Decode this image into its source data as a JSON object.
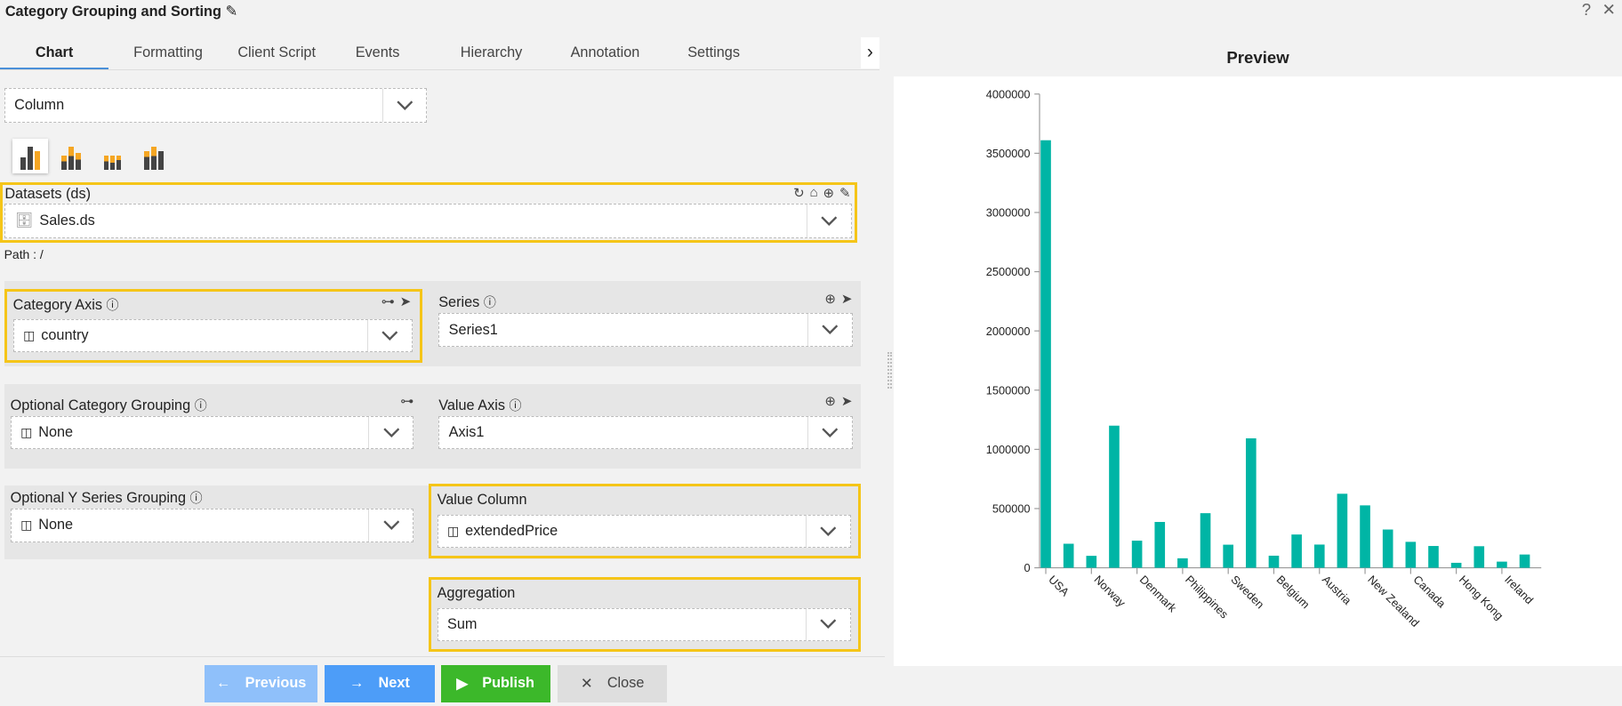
{
  "header": {
    "title": "Category Grouping and Sorting",
    "help": "?",
    "close": "✕"
  },
  "tabs": [
    "Chart",
    "Formatting",
    "Client Script",
    "Events",
    "Hierarchy",
    "Annotation",
    "Settings"
  ],
  "chart_type": {
    "value": "Column",
    "variants": [
      "clustered-column-icon",
      "stacked-column-icon",
      "100-stacked-column-icon",
      "grouped-stacked-column-icon"
    ]
  },
  "datasets": {
    "label": "Datasets (ds)",
    "value": "Sales.ds",
    "path": "Path : /"
  },
  "category_axis": {
    "label": "Category Axis",
    "value": "country"
  },
  "series": {
    "label": "Series",
    "value": "Series1"
  },
  "category_grouping": {
    "label": "Optional Category Grouping",
    "value": "None"
  },
  "value_axis": {
    "label": "Value Axis",
    "value": "Axis1"
  },
  "y_series_grouping": {
    "label": "Optional Y Series Grouping",
    "value": "None"
  },
  "value_column": {
    "label": "Value Column",
    "value": "extendedPrice"
  },
  "aggregation": {
    "label": "Aggregation",
    "value": "Sum"
  },
  "footer": {
    "previous": "Previous",
    "next": "Next",
    "publish": "Publish",
    "close": "Close"
  },
  "preview": {
    "title": "Preview"
  },
  "colors": {
    "highlight": "#f5c518",
    "bar": "#00b5a5",
    "next": "#4d9df8",
    "publish": "#3cb82a"
  },
  "chart_data": {
    "type": "bar",
    "categories": [
      "USA",
      "",
      "Norway",
      "",
      "Denmark",
      "",
      "Philippines",
      "",
      "Sweden",
      "",
      "Belgium",
      "",
      "Austria",
      "",
      "New Zealand",
      "",
      "Canada",
      "",
      "Hong Kong",
      "",
      "Ireland",
      ""
    ],
    "values": [
      3610000,
      203000,
      101000,
      1200000,
      229000,
      387000,
      80000,
      461000,
      195000,
      1093000,
      102000,
      281000,
      196000,
      625000,
      527000,
      323000,
      219000,
      184000,
      42000,
      182000,
      52000,
      112000
    ],
    "yticks": [
      "0",
      "500000",
      "1000000",
      "1500000",
      "2000000",
      "2500000",
      "3000000",
      "3500000",
      "4000000"
    ],
    "ylim": [
      0,
      4000000
    ],
    "grid": false
  }
}
